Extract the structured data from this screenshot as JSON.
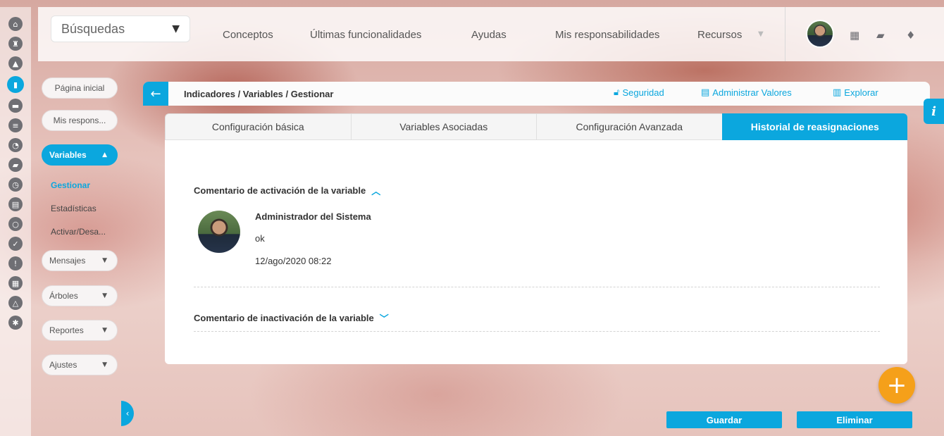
{
  "rail": {
    "icons": [
      "home-icon",
      "tower-icon",
      "triangle-icon",
      "bar-chart-icon",
      "presentation-icon",
      "list-icon",
      "pie-chart-icon",
      "folder-icon",
      "clock-icon",
      "document-icon",
      "circle-dashed-icon",
      "check-circle-icon",
      "warning-icon",
      "calendar-icon",
      "network-icon",
      "gear-icon"
    ],
    "active_index": 3
  },
  "topbar": {
    "search_label": "Búsquedas",
    "nav": [
      "Conceptos",
      "Últimas funcionalidades",
      "Ayudas",
      "Mis responsabilidades",
      "Recursos"
    ],
    "icons": [
      "calendar-icon",
      "book-icon",
      "bell-icon"
    ]
  },
  "sidebar": {
    "home": "Página inicial",
    "mis_respons": "Mis respons...",
    "variables": "Variables",
    "sub_items": [
      "Gestionar",
      "Estadísticas",
      "Activar/Desa..."
    ],
    "groups": [
      "Mensajes",
      "Árboles",
      "Reportes",
      "Ajustes"
    ]
  },
  "header": {
    "breadcrumb": "Indicadores / Variables / Gestionar",
    "links": [
      "Seguridad",
      "Administrar Valores",
      "Explorar"
    ]
  },
  "tabs": [
    "Configuración básica",
    "Variables Asociadas",
    "Configuración Avanzada",
    "Historial de reasignaciones"
  ],
  "active_tab": 3,
  "sections": {
    "activation": {
      "title": "Comentario de activación de la variable",
      "user": "Administrador del Sistema",
      "comment": "ok",
      "date": "12/ago/2020 08:22"
    },
    "inactivation": {
      "title": "Comentario de inactivación de la variable"
    }
  },
  "info_label": "i",
  "fab_label": "+",
  "buttons": {
    "save": "Guardar",
    "delete": "Eliminar"
  },
  "colors": {
    "accent": "#0ba7de",
    "fab": "#f5a01a",
    "rail_icon": "#6f6f74"
  }
}
